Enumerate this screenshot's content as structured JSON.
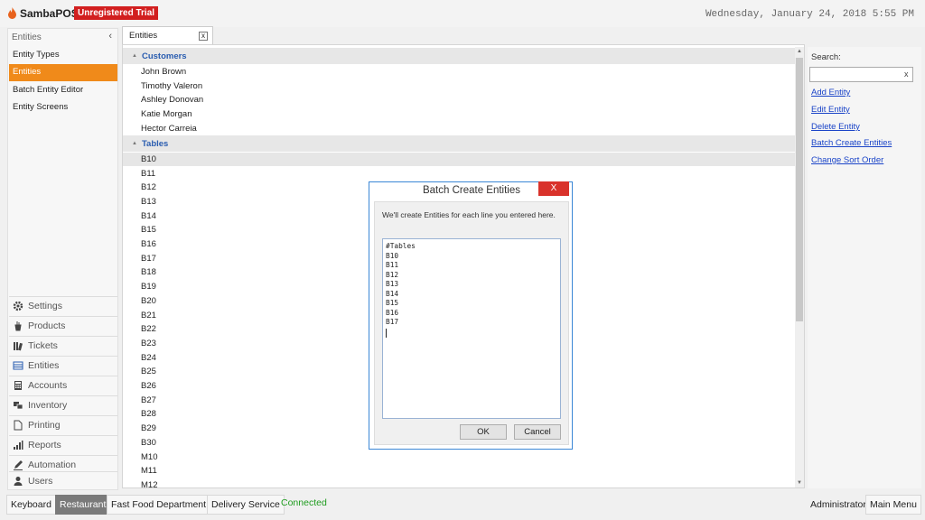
{
  "header": {
    "brand": "SambaPOS",
    "trial_badge": "Unregistered Trial",
    "datetime": "Wednesday, January 24, 2018 5:55 PM"
  },
  "sidebar": {
    "title": "Entities",
    "collapse_icon": "chevron-left-icon",
    "items": [
      {
        "label": "Entity Types",
        "active": false
      },
      {
        "label": "Entities",
        "active": true
      },
      {
        "label": "Batch Entity Editor",
        "active": false
      },
      {
        "label": "Entity Screens",
        "active": false
      }
    ],
    "nav": [
      {
        "label": "Settings",
        "icon": "gear-icon"
      },
      {
        "label": "Products",
        "icon": "products-icon"
      },
      {
        "label": "Tickets",
        "icon": "tickets-icon"
      },
      {
        "label": "Entities",
        "icon": "entities-icon"
      },
      {
        "label": "Accounts",
        "icon": "calculator-icon"
      },
      {
        "label": "Inventory",
        "icon": "inventory-icon"
      },
      {
        "label": "Printing",
        "icon": "document-icon"
      },
      {
        "label": "Reports",
        "icon": "bar-chart-icon"
      },
      {
        "label": "Automation",
        "icon": "pencil-icon"
      },
      {
        "label": "Users",
        "icon": "user-icon"
      }
    ]
  },
  "tab": {
    "label": "Entities",
    "close": "x"
  },
  "list": {
    "groups": [
      {
        "label": "Customers",
        "rows": [
          "John Brown",
          "Timothy Valeron",
          "Ashley Donovan",
          "Katie Morgan",
          "Hector Carreia"
        ]
      },
      {
        "label": "Tables",
        "rows": [
          "B10",
          "B11",
          "B12",
          "B13",
          "B14",
          "B15",
          "B16",
          "B17",
          "B18",
          "B19",
          "B20",
          "B21",
          "B22",
          "B23",
          "B24",
          "B25",
          "B26",
          "B27",
          "B28",
          "B29",
          "B30",
          "M10",
          "M11",
          "M12"
        ]
      }
    ],
    "selected_row": "B10"
  },
  "right_panel": {
    "search_label": "Search:",
    "search_value": "",
    "search_clear": "x",
    "actions": [
      "Add Entity",
      "Edit Entity",
      "Delete Entity",
      "Batch Create Entities",
      "Change Sort Order"
    ]
  },
  "dialog": {
    "title": "Batch Create Entities",
    "close": "X",
    "message": "We'll create Entities for each line you entered here.",
    "lines": [
      "#Tables",
      "B10",
      "B11",
      "B12",
      "B13",
      "B14",
      "B15",
      "B16",
      "B17"
    ],
    "ok_label": "OK",
    "cancel_label": "Cancel"
  },
  "footer": {
    "keyboard": "Keyboard",
    "restaurant": "Restaurant",
    "fast_food": "Fast Food Department",
    "delivery": "Delivery Service",
    "status": "Connected",
    "user": "Administrator",
    "main_menu": "Main Menu"
  },
  "colors": {
    "accent_orange": "#f08a1a",
    "trial_red": "#d21f1f",
    "link_blue": "#1a44c8",
    "group_blue": "#2a5db0",
    "connected_green": "#1e9c1e",
    "dialog_border": "#3b87d6"
  }
}
